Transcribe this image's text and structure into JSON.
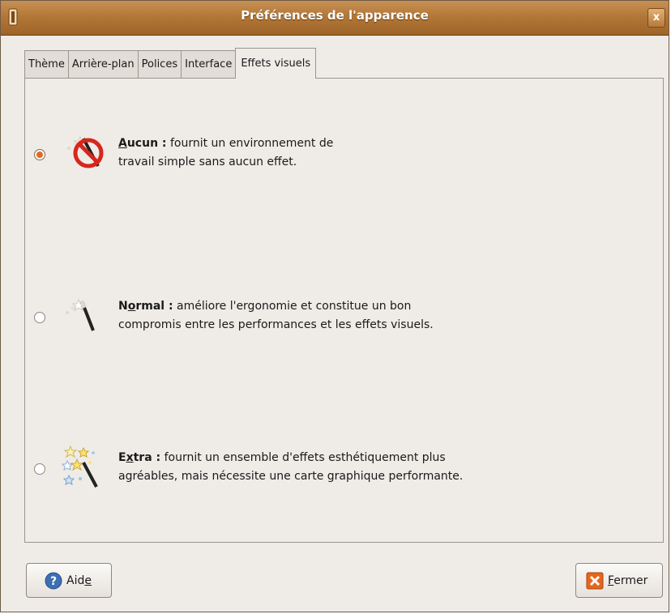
{
  "window": {
    "title": "Préférences de l'apparence",
    "close_glyph": "x",
    "accent_color": "#b37838"
  },
  "tabs": [
    {
      "label": "Thème"
    },
    {
      "label": "Arrière-plan"
    },
    {
      "label": "Polices"
    },
    {
      "label": "Interface"
    },
    {
      "label": "Effets visuels",
      "active": true
    }
  ],
  "options": [
    {
      "key": "none",
      "icon": "no-effects-icon",
      "name_first": "A",
      "name_rest": "ucun :",
      "line1": " fournit un environnement de",
      "line2": "travail simple sans aucun effet.",
      "selected": true
    },
    {
      "key": "normal",
      "icon": "magic-wand-icon",
      "name_first": "N",
      "name_mid": "o",
      "name_rest": "rmal :",
      "line1": " améliore l'ergonomie et constitue un bon",
      "line2": "compromis entre les performances et les effets visuels.",
      "selected": false
    },
    {
      "key": "extra",
      "icon": "sparkle-wand-icon",
      "name_first": "E",
      "name_mid": "x",
      "name_rest": "tra :",
      "line1": " fournit un ensemble d'effets esthétiquement plus",
      "line2": "agréables, mais nécessite une carte graphique performante.",
      "selected": false
    }
  ],
  "buttons": {
    "help": {
      "label_a": "Aid",
      "label_u": "e",
      "icon": "help-icon"
    },
    "close": {
      "label_u": "F",
      "label_b": "ermer",
      "icon": "close-icon"
    }
  }
}
